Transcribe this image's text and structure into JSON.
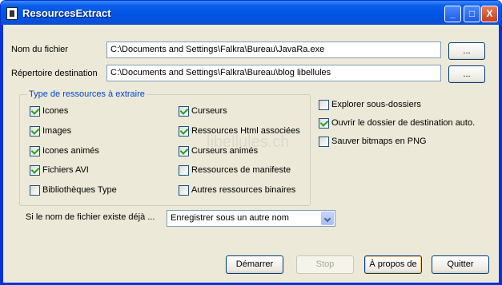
{
  "window": {
    "title": "ResourcesExtract",
    "minimize_label": "_",
    "maximize_label": "□",
    "close_label": "X"
  },
  "file": {
    "label": "Nom du fichier",
    "value": "C:\\Documents and Settings\\Falkra\\Bureau\\JavaRa.exe",
    "browse_label": "..."
  },
  "dest": {
    "label": "Répertoire destination",
    "value": "C:\\Documents and Settings\\Falkra\\Bureau\\blog libellules",
    "browse_label": "..."
  },
  "resource_types": {
    "title": "Type de ressources à extraire",
    "items": [
      {
        "label": "Icones",
        "checked": true
      },
      {
        "label": "Images",
        "checked": true
      },
      {
        "label": "Icones animés",
        "checked": true
      },
      {
        "label": "Fichiers AVI",
        "checked": true
      },
      {
        "label": "Bibliothèques Type",
        "checked": false
      },
      {
        "label": "Curseurs",
        "checked": true
      },
      {
        "label": "Ressources Html associées",
        "checked": true
      },
      {
        "label": "Curseurs animés",
        "checked": true
      },
      {
        "label": "Ressources de manifeste",
        "checked": false
      },
      {
        "label": "Autres ressources binaires",
        "checked": false
      }
    ]
  },
  "options": {
    "items": [
      {
        "label": "Explorer sous-dossiers",
        "checked": false
      },
      {
        "label": "Ouvrir le dossier de destination auto.",
        "checked": true
      },
      {
        "label": "Sauver bitmaps en PNG",
        "checked": false
      }
    ]
  },
  "exists": {
    "label": "Si le nom de fichier existe déjà ...",
    "selected": "Enregistrer sous un autre nom"
  },
  "watermark": "libellules.ch",
  "buttons": {
    "start": "Démarrer",
    "stop": "Stop",
    "about": "À propos de",
    "quit": "Quitter"
  },
  "colors": {
    "titlebar": "#0054e3",
    "dialog_bg": "#ece9d8",
    "group_title": "#0046d5",
    "check": "#21a121"
  }
}
